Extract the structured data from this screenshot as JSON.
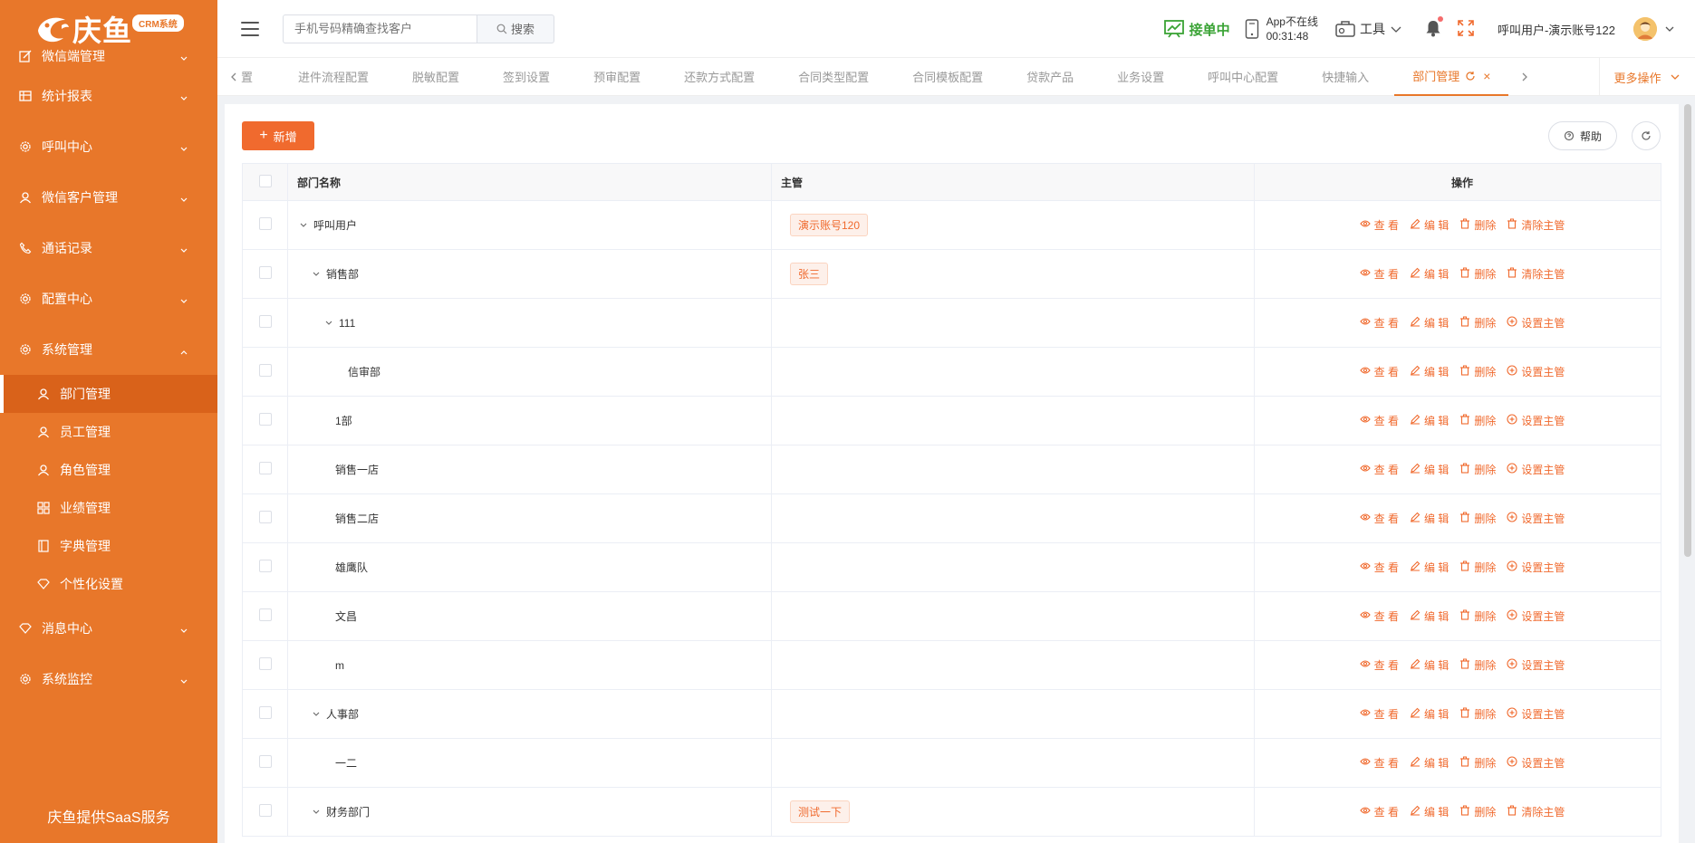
{
  "brand": {
    "name": "庆鱼",
    "badge": "CRM系统"
  },
  "sidebar": {
    "items": [
      {
        "label": "微信端管理",
        "icon": "edit-icon"
      },
      {
        "label": "统计报表",
        "icon": "table-icon"
      },
      {
        "label": "呼叫中心",
        "icon": "gear-icon"
      },
      {
        "label": "微信客户管理",
        "icon": "user-icon"
      },
      {
        "label": "通话记录",
        "icon": "phone-icon"
      },
      {
        "label": "配置中心",
        "icon": "gear-icon"
      },
      {
        "label": "系统管理",
        "icon": "gear-icon"
      }
    ],
    "sub_items": [
      {
        "label": "部门管理",
        "icon": "user-icon",
        "active": true
      },
      {
        "label": "员工管理",
        "icon": "user-icon"
      },
      {
        "label": "角色管理",
        "icon": "user-icon"
      },
      {
        "label": "业绩管理",
        "icon": "grid-icon"
      },
      {
        "label": "字典管理",
        "icon": "book-icon"
      },
      {
        "label": "个性化设置",
        "icon": "diamond-icon"
      }
    ],
    "bottom_items": [
      {
        "label": "消息中心",
        "icon": "diamond-icon"
      },
      {
        "label": "系统监控",
        "icon": "gear-icon"
      }
    ],
    "footer": "庆鱼提供SaaS服务"
  },
  "header": {
    "search_placeholder": "手机号码精确查找客户",
    "search_button": "搜索",
    "status": "接单中",
    "app_status": "App不在线",
    "app_time": "00:31:48",
    "tools": "工具",
    "user": "呼叫用户-演示账号122"
  },
  "tabs": {
    "items": [
      "置",
      "进件流程配置",
      "脱敏配置",
      "签到设置",
      "预审配置",
      "还款方式配置",
      "合同类型配置",
      "合同模板配置",
      "贷款产品",
      "业务设置",
      "呼叫中心配置",
      "快捷输入"
    ],
    "active": "部门管理",
    "more": "更多操作"
  },
  "toolbar": {
    "add": "新增",
    "help": "帮助"
  },
  "table": {
    "headers": [
      "部门名称",
      "主管",
      "操作"
    ],
    "rows": [
      {
        "name": "呼叫用户",
        "level": 0,
        "expand": true,
        "manager": "演示账号120",
        "last_op": "清除主管"
      },
      {
        "name": "销售部",
        "level": 1,
        "expand": true,
        "manager": "张三",
        "last_op": "清除主管"
      },
      {
        "name": "111",
        "level": 2,
        "expand": true,
        "manager": "",
        "last_op": "设置主管"
      },
      {
        "name": "信审部",
        "level": 3,
        "expand": false,
        "manager": "",
        "last_op": "设置主管"
      },
      {
        "name": "1部",
        "level": 2,
        "expand": false,
        "manager": "",
        "last_op": "设置主管"
      },
      {
        "name": "销售一店",
        "level": 2,
        "expand": false,
        "manager": "",
        "last_op": "设置主管"
      },
      {
        "name": "销售二店",
        "level": 2,
        "expand": false,
        "manager": "",
        "last_op": "设置主管"
      },
      {
        "name": "雄鹰队",
        "level": 2,
        "expand": false,
        "manager": "",
        "last_op": "设置主管"
      },
      {
        "name": "文昌",
        "level": 2,
        "expand": false,
        "manager": "",
        "last_op": "设置主管"
      },
      {
        "name": "m",
        "level": 2,
        "expand": false,
        "manager": "",
        "last_op": "设置主管"
      },
      {
        "name": "人事部",
        "level": 1,
        "expand": true,
        "manager": "",
        "last_op": "设置主管"
      },
      {
        "name": "一二",
        "level": 2,
        "expand": false,
        "manager": "",
        "last_op": "设置主管"
      },
      {
        "name": "财务部门",
        "level": 1,
        "expand": true,
        "manager": "测试一下",
        "last_op": "清除主管"
      }
    ],
    "ops": {
      "view": "查 看",
      "edit": "编 辑",
      "delete": "删除"
    }
  },
  "colors": {
    "sidebar": "#e8772a",
    "accent": "#f06a2e",
    "active_sub": "#d9621a",
    "online": "#3aa335"
  }
}
